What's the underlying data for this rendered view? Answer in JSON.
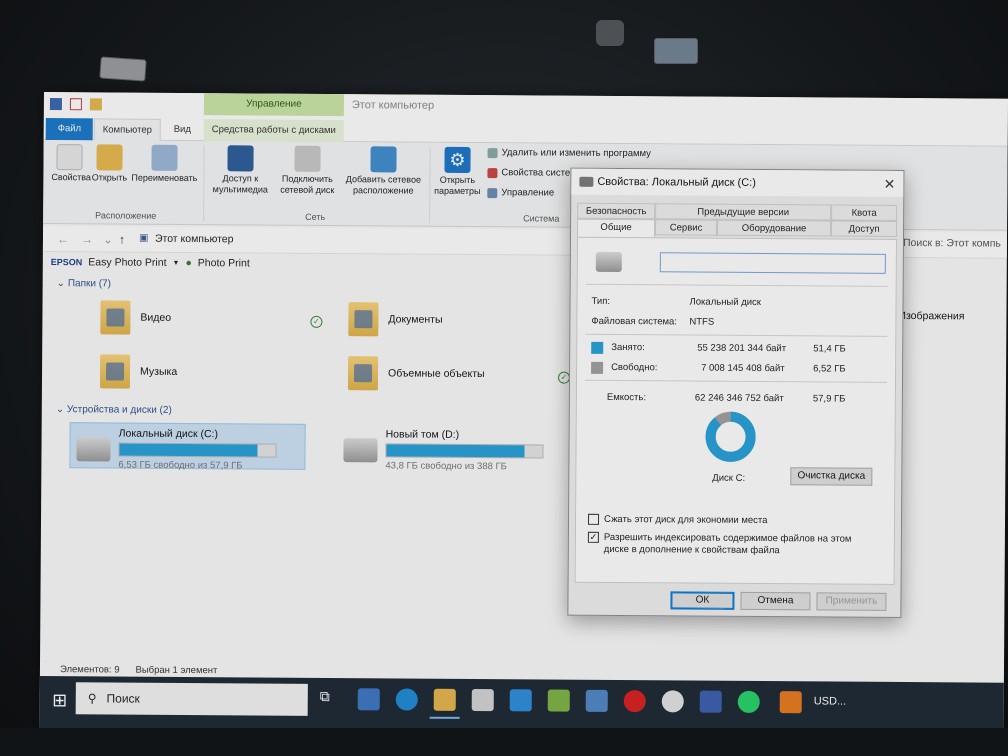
{
  "explorer": {
    "context_tab": "Управление",
    "window_title": "Этот компьютер",
    "tabs": {
      "file": "Файл",
      "computer": "Компьютер",
      "view": "Вид",
      "drive_tools": "Средства работы с дисками"
    },
    "ribbon": {
      "location": {
        "properties": "Свойства",
        "open": "Открыть",
        "rename": "Переименовать",
        "group": "Расположение"
      },
      "network": {
        "media": "Доступ к мультимедиа",
        "map_drive": "Подключить сетевой диск",
        "add_location": "Добавить сетевое расположение",
        "group": "Сеть"
      },
      "system": {
        "open_settings": "Открыть параметры",
        "uninstall": "Удалить или изменить программу",
        "properties": "Свойства системы",
        "manage": "Управление",
        "group": "Система"
      }
    },
    "address": {
      "path": "Этот компьютер",
      "search_placeholder": "Поиск в: Этот компь"
    },
    "epson": {
      "logo": "EPSON",
      "app1": "Easy Photo Print",
      "app2": "Photo Print"
    },
    "folders_header": "Папки (7)",
    "folders": [
      "Видео",
      "Документы",
      "Изображения",
      "Музыка",
      "Объемные объекты"
    ],
    "devices_header": "Устройства и диски (2)",
    "drives": [
      {
        "name": "Локальный диск (C:)",
        "free": "6,53 ГБ свободно из 57,9 ГБ",
        "used_fraction": 0.887
      },
      {
        "name": "Новый том (D:)",
        "free": "43,8 ГБ свободно из 388 ГБ",
        "used_fraction": 0.887
      }
    ],
    "status": {
      "items": "Элементов: 9",
      "selected": "Выбран 1 элемент"
    }
  },
  "taskbar": {
    "search": "Поиск",
    "tray_text": "USD..."
  },
  "dialog": {
    "title": "Свойства: Локальный диск (C:)",
    "tabs_top": [
      "Безопасность",
      "Предыдущие версии",
      "Квота"
    ],
    "tabs_bottom": [
      "Общие",
      "Сервис",
      "Оборудование",
      "Доступ"
    ],
    "name_value": "",
    "type_label": "Тип:",
    "type_value": "Локальный диск",
    "fs_label": "Файловая система:",
    "fs_value": "NTFS",
    "used_label": "Занято:",
    "used_bytes": "55 238 201 344 байт",
    "used_gb": "51,4 ГБ",
    "free_label": "Свободно:",
    "free_bytes": "7 008 145 408 байт",
    "free_gb": "6,52 ГБ",
    "capacity_label": "Емкость:",
    "capacity_bytes": "62 246 346 752 байт",
    "capacity_gb": "57,9 ГБ",
    "disk_label": "Диск C:",
    "cleanup": "Очистка диска",
    "compress": "Сжать этот диск для экономии места",
    "index": "Разрешить индексировать содержимое файлов на этом диске в дополнение к свойствам файла",
    "ok": "ОК",
    "cancel": "Отмена",
    "apply": "Применить",
    "used_color": "#26a0da",
    "free_color": "#a0a0a0"
  }
}
